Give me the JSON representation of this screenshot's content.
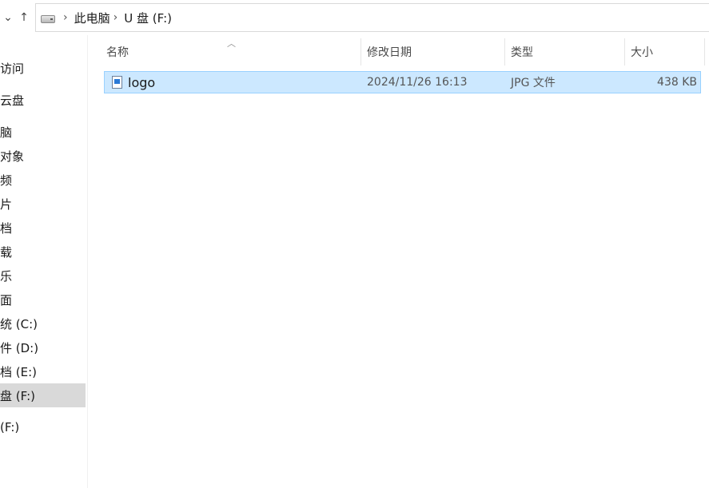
{
  "address_bar": {
    "crumbs": [
      "此电脑",
      "U 盘 (F:)"
    ]
  },
  "nav_pane": {
    "items": [
      {
        "label": "访问"
      },
      {
        "label": "云盘"
      },
      {
        "label": "脑"
      },
      {
        "label": "对象"
      },
      {
        "label": "频"
      },
      {
        "label": "片"
      },
      {
        "label": "档"
      },
      {
        "label": "载"
      },
      {
        "label": "乐"
      },
      {
        "label": "面"
      },
      {
        "label": "统 (C:)"
      },
      {
        "label": "件 (D:)"
      },
      {
        "label": "档 (E:)"
      },
      {
        "label": "盘 (F:)",
        "selected": true
      },
      {
        "label": "(F:)"
      }
    ]
  },
  "columns": {
    "name": "名称",
    "modified": "修改日期",
    "type": "类型",
    "size": "大小"
  },
  "files": [
    {
      "name": "logo",
      "modified": "2024/11/26 16:13",
      "type": "JPG 文件",
      "size": "438 KB",
      "selected": true
    }
  ]
}
